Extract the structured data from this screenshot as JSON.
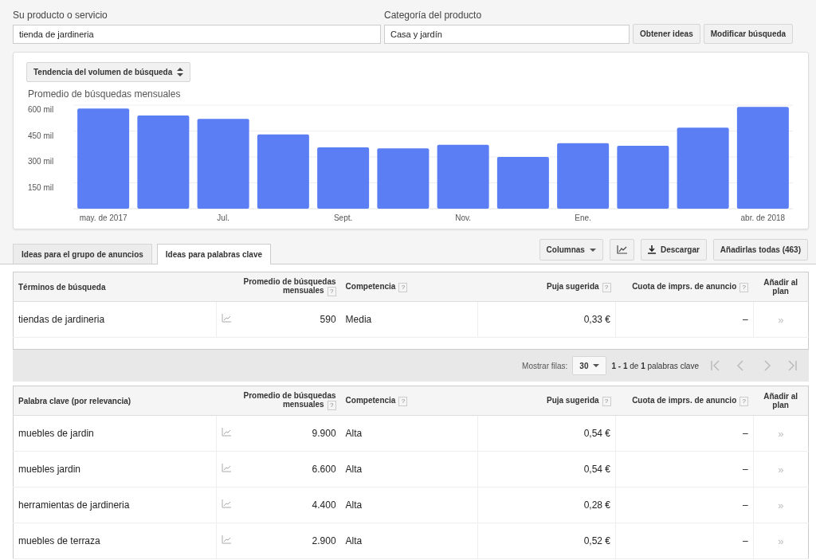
{
  "search_form": {
    "product_label": "Su producto o servicio",
    "product_value": "tienda de jardineria",
    "category_label": "Categoría del producto",
    "category_value": "Casa y jardín",
    "buttons": [
      "Obtener ideas",
      "Modificar búsqueda"
    ]
  },
  "chart_panel": {
    "selector": "Tendencia del volumen de búsqueda",
    "chart_data": {
      "type": "bar",
      "title": "Promedio de búsquedas mensuales",
      "categories": [
        "may. de 2017",
        null,
        "Jul.",
        null,
        "Sept.",
        null,
        "Nov.",
        null,
        "Ene.",
        null,
        null,
        "abr. de 2018"
      ],
      "series": [
        {
          "color": "#5b7ef4",
          "values": [
            580,
            540,
            520,
            430,
            355,
            350,
            370,
            300,
            380,
            365,
            470,
            590
          ]
        }
      ],
      "ylim": [
        0,
        600
      ],
      "grid": true,
      "yticks": [
        {
          "value": 150,
          "label": "150 mil"
        },
        {
          "value": 300,
          "label": "300 mil"
        },
        {
          "value": 450,
          "label": "450 mil"
        },
        {
          "value": 600,
          "label": "600 mil"
        }
      ]
    }
  },
  "tabs": [
    {
      "label": "Ideas para el grupo de anuncios",
      "selected": false
    },
    {
      "label": "Ideas para palabras clave",
      "selected": true
    }
  ],
  "toolbar": {
    "columns": "Columnas",
    "download": "Descargar",
    "add_all": "Añadirlas todas (463)"
  },
  "search_terms_table": {
    "columns": [
      {
        "label": "Términos de búsqueda"
      },
      {
        "label": "Promedio de búsquedas mensuales",
        "help": "?"
      },
      {
        "label": "Competencia",
        "help": "?"
      },
      {
        "label": "Puja sugerida",
        "help": "?"
      },
      {
        "label": "Cuota de imprs. de anuncio",
        "help": "?"
      },
      {
        "label": "Añadir al plan"
      }
    ],
    "rows": [
      {
        "term": "tiendas de jardineria",
        "searches": "590",
        "competition": "Media",
        "bid": "0,33 €",
        "share": "–",
        "add": "»"
      }
    ]
  },
  "pagination": {
    "label": "Mostrar filas:",
    "rows": "30",
    "range": "**1 - 1** de **1** palabras clave"
  },
  "keywords_table": {
    "columns": [
      {
        "label": "Palabra clave (por relevancia)"
      },
      {
        "label": "Promedio de búsquedas mensuales",
        "help": "?"
      },
      {
        "label": "Competencia",
        "help": "?"
      },
      {
        "label": "Puja sugerida",
        "help": "?"
      },
      {
        "label": "Cuota de imprs. de anuncio",
        "help": "?"
      },
      {
        "label": "Añadir al plan"
      }
    ],
    "rows": [
      {
        "term": "muebles de jardin",
        "searches": "9.900",
        "competition": "Alta",
        "bid": "0,54 €",
        "share": "–",
        "add": "»"
      },
      {
        "term": "muebles jardin",
        "searches": "6.600",
        "competition": "Alta",
        "bid": "0,54 €",
        "share": "–",
        "add": "»"
      },
      {
        "term": "herramientas de jardineria",
        "searches": "4.400",
        "competition": "Alta",
        "bid": "0,28 €",
        "share": "–",
        "add": "»"
      },
      {
        "term": "muebles de terraza",
        "searches": "2.900",
        "competition": "Alta",
        "bid": "0,52 €",
        "share": "–",
        "add": "»"
      }
    ]
  }
}
